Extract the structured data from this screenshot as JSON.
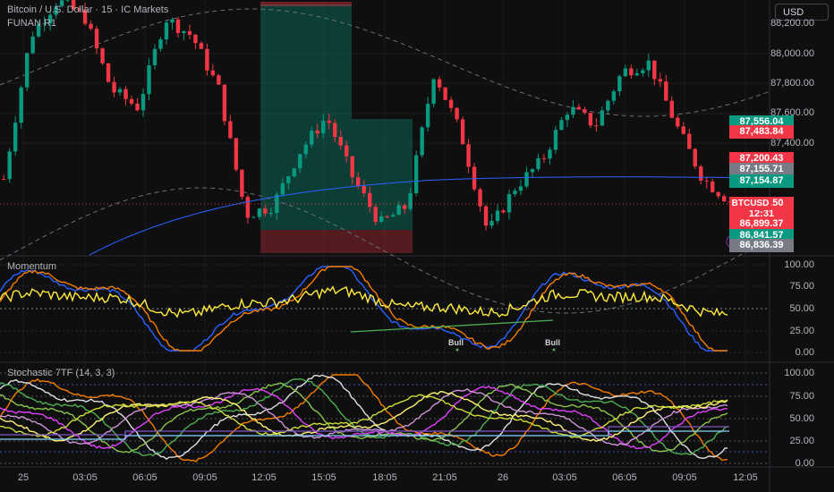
{
  "header": {
    "symbol_title": "Bitcoin / U.S. Dollar · 15 · IC Markets",
    "indicator": "FUNAN R1"
  },
  "currency_button": "USD",
  "price_axis": [
    "88,200.00",
    "88,000.00",
    "87,800.00",
    "87,600.00",
    "87,400.00"
  ],
  "price_tags": [
    {
      "text": "87,556.04",
      "color": "#089981"
    },
    {
      "text": "87,483.84",
      "color": "#f23645"
    },
    {
      "text": "87,200.43",
      "color": "#f23645"
    },
    {
      "text": "87,155.71",
      "color": "#787b86"
    },
    {
      "text": "87,154.87",
      "color": "#089981"
    },
    {
      "text": "87,012.50",
      "color": "#f23645"
    },
    {
      "text": "12:31",
      "color": "#f23645"
    },
    {
      "text": "86,899.37",
      "color": "#f23645"
    },
    {
      "text": "86,841.57",
      "color": "#089981"
    },
    {
      "text": "86,836.39",
      "color": "#787b86"
    }
  ],
  "symbol_tag": "BTCUSD",
  "momentum": {
    "title": "Momentum",
    "axis": [
      "100.00",
      "75.00",
      "50.00",
      "25.00",
      "0.00"
    ],
    "signals": [
      "Bull",
      "Bull"
    ]
  },
  "stochastic": {
    "title": "Stochastic 7TF (14, 3, 3)",
    "axis": [
      "100.00",
      "75.00",
      "50.00",
      "25.00",
      "0.00"
    ]
  },
  "time_axis": [
    "25",
    "03:05",
    "06:05",
    "09:05",
    "12:05",
    "15:05",
    "18:05",
    "21:05",
    "26",
    "03:05",
    "06:05",
    "09:05",
    "12:05"
  ],
  "chart_data": {
    "type": "candlestick",
    "symbol": "BTCUSD",
    "interval": "15",
    "ylim": [
      86662,
      88360
    ],
    "price_path": [
      87160,
      88120,
      88360,
      88250,
      87760,
      87640,
      88240,
      88120,
      87760,
      86920,
      86980,
      87340,
      87580,
      87160,
      86860,
      86980,
      87880,
      87460,
      86800,
      87100,
      87280,
      87640,
      87520,
      87880,
      87940,
      87520,
      87160,
      87013
    ],
    "colors": {
      "up": "#089981",
      "down": "#f23645",
      "ma": "#2962ff"
    }
  },
  "colors": {
    "bg": "#0f0f0f",
    "grid": "#1e1e1e"
  }
}
